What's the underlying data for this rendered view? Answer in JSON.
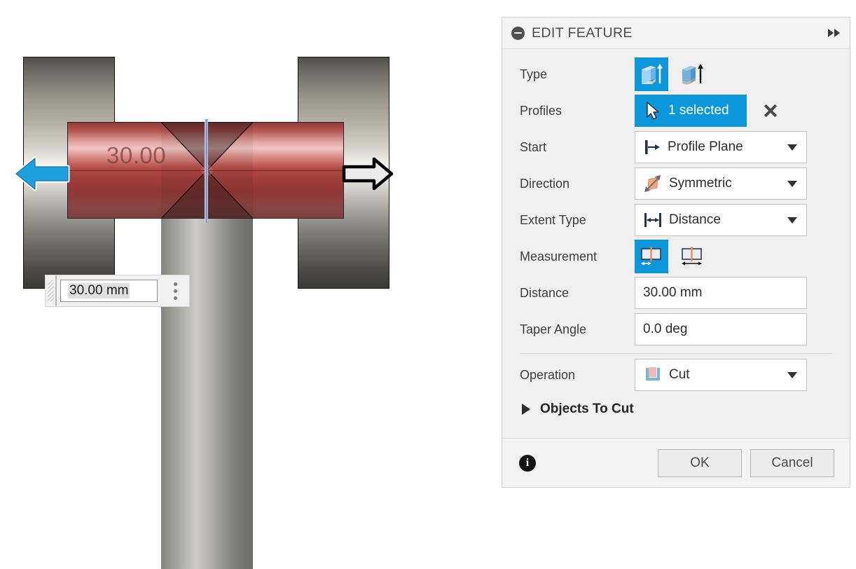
{
  "viewport": {
    "dimension_label": "30.00",
    "dim_widget": {
      "value": "30.00 mm",
      "grip_icon": "drag-grip-icon",
      "menu_icon": "kebab-menu-icon"
    },
    "manipulators": {
      "left_arrow_icon": "direction-arrow-left-icon",
      "right_arrow_icon": "direction-arrow-right-icon"
    }
  },
  "panel": {
    "title": "EDIT FEATURE",
    "collapse_icon": "collapse-minus-icon",
    "expand_icon": "double-chevron-right-icon",
    "rows": {
      "type": {
        "label": "Type",
        "options": [
          {
            "icon": "solid-extrude-icon",
            "selected": true
          },
          {
            "icon": "surface-extrude-icon",
            "selected": false
          }
        ]
      },
      "profiles": {
        "label": "Profiles",
        "chip_icon": "cursor-arrow-icon",
        "chip_text": "1 selected",
        "clear_icon": "clear-selection-x-icon"
      },
      "start": {
        "label": "Start",
        "value": "Profile Plane",
        "icon": "profile-plane-icon",
        "caret_icon": "chevron-down-icon"
      },
      "direction": {
        "label": "Direction",
        "value": "Symmetric",
        "icon": "symmetric-direction-icon",
        "caret_icon": "chevron-down-icon"
      },
      "extent_type": {
        "label": "Extent Type",
        "value": "Distance",
        "icon": "distance-extent-icon",
        "caret_icon": "chevron-down-icon"
      },
      "measurement": {
        "label": "Measurement",
        "options": [
          {
            "icon": "half-length-measurement-icon",
            "selected": true
          },
          {
            "icon": "whole-length-measurement-icon",
            "selected": false
          }
        ]
      },
      "distance": {
        "label": "Distance",
        "value": "30.00 mm"
      },
      "taper_angle": {
        "label": "Taper Angle",
        "value": "0.0 deg"
      },
      "operation": {
        "label": "Operation",
        "value": "Cut",
        "icon": "cut-operation-icon",
        "caret_icon": "chevron-down-icon"
      },
      "objects_to_cut": {
        "label": "Objects To Cut",
        "expander_icon": "triangle-right-icon"
      }
    },
    "footer": {
      "info_icon": "info-icon",
      "ok_label": "OK",
      "cancel_label": "Cancel"
    }
  },
  "colors": {
    "accent_blue": "#0c97da",
    "panel_bg": "#f0f0f0",
    "field_bg": "#ffffff",
    "model_red": "#b34a45",
    "orange_accent": "#ef8b52",
    "navy": "#22314f"
  }
}
